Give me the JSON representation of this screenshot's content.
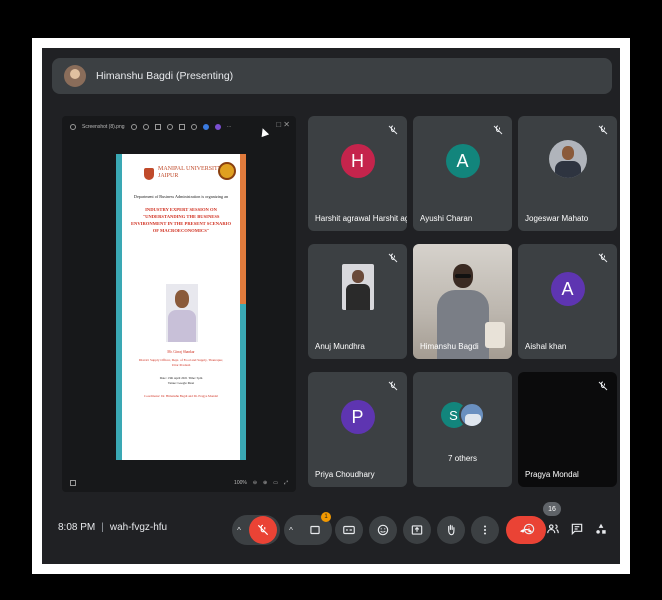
{
  "meeting": {
    "presenter_label": "Himanshu Bagdi (Presenting)",
    "time": "8:08 PM",
    "separator": "|",
    "code": "wah-fvgz-hfu",
    "participant_count": "16",
    "reaction_count": "1"
  },
  "share": {
    "file_name": "Screenshot (8).png",
    "zoom": "100%"
  },
  "poster": {
    "university": "MANIPAL UNIVERSITY",
    "city": "JAIPUR",
    "department": "Department of Business Administration is organizing an",
    "title_line1": "INDUSTRY EXPERT SESSION ON",
    "title_line2": "\"UNDERSTANDING THE BUSINESS",
    "title_line3": "ENVIRONMENT IN THE PRESENT SCENARIO",
    "title_line4": "OF MACROECONOMICS\"",
    "speaker": "Mr. Girraj Shankar",
    "designation_line1": "District Supply Officer, Dept. of Food and Supply, Thanrapur,",
    "designation_line2": "Uttar Pradesh",
    "date_line": "Date: 13th April 2021 Time: 5pm",
    "venue_line": "Venue: Google Meet",
    "coordinators": "Coordinator: Dr. Himanshu Bagdi and Dr. Pragya Mondal"
  },
  "participants": [
    {
      "name": "Harshit agrawal Harshit ag...",
      "initial": "H",
      "color": "#c5244c"
    },
    {
      "name": "Ayushi Charan",
      "initial": "A",
      "color": "#12857c"
    },
    {
      "name": "Jogeswar Mahato",
      "initial": "",
      "color": ""
    },
    {
      "name": "Anuj Mundhra",
      "initial": "",
      "color": ""
    },
    {
      "name": "Himanshu Bagdi",
      "initial": "",
      "color": ""
    },
    {
      "name": "Aishal khan",
      "initial": "A",
      "color": "#5e35b1"
    },
    {
      "name": "Priya Choudhary",
      "initial": "P",
      "color": "#5e35b1"
    },
    {
      "name": "7 others",
      "initial": "S",
      "color": "#12857c"
    },
    {
      "name": "Pragya Mondal",
      "initial": "",
      "color": ""
    }
  ],
  "colors": {
    "background": "#202124",
    "tile": "#3c4043",
    "danger": "#ea4335",
    "accent": "#f29900"
  },
  "icons": [
    "mic-off-icon",
    "present-icon",
    "captions-icon",
    "emoji-icon",
    "share-screen-icon",
    "raise-hand-icon",
    "more-icon",
    "call-end-icon",
    "info-icon",
    "people-icon",
    "chat-icon",
    "activities-icon"
  ]
}
